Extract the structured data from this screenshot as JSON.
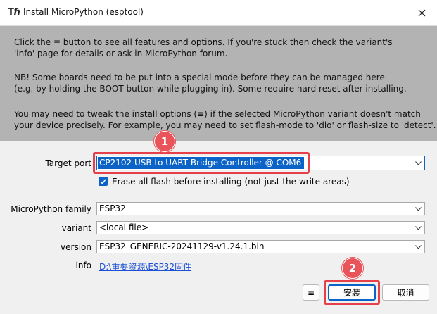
{
  "window": {
    "title": "Install MicroPython (esptool)",
    "icon": "thonny-logo-icon"
  },
  "info": {
    "paragraph1": "Click the ≡ button to see all features and options. If you're stuck then check the variant's\n'info' page for details or ask in MicroPython forum.",
    "paragraph2": "NB! Some boards need to be put into a special mode before they can be managed here\n(e.g. by holding the BOOT button while plugging in). Some require hard reset after installing.",
    "paragraph3": "You may need to tweak the install options (≡) if the selected MicroPython variant doesn't match\nyour device precisely. For example, you may need to set flash-mode to 'dio' or flash-size to 'detect'."
  },
  "form": {
    "target_port_label": "Target port",
    "target_port_value": "CP2102 USB to UART Bridge Controller @ COM6",
    "erase_label": "Erase all flash before installing (not just the write areas)",
    "erase_checked": true,
    "family_label": "MicroPython family",
    "family_value": "ESP32",
    "variant_label": "variant",
    "variant_value": "<local file>",
    "version_label": "version",
    "version_value": "ESP32_GENERIC-20241129-v1.24.1.bin",
    "info_label": "info",
    "info_link": "D:\\重要资源\\ESP32固件"
  },
  "buttons": {
    "menu": "≡",
    "install": "安装",
    "cancel": "取消"
  },
  "annotations": {
    "badge1": "1",
    "badge2": "2",
    "color": "#e8404a"
  },
  "colors": {
    "accent": "#0b63c8",
    "info_panel": "#b3b3b3",
    "link": "#1a4fd6"
  }
}
